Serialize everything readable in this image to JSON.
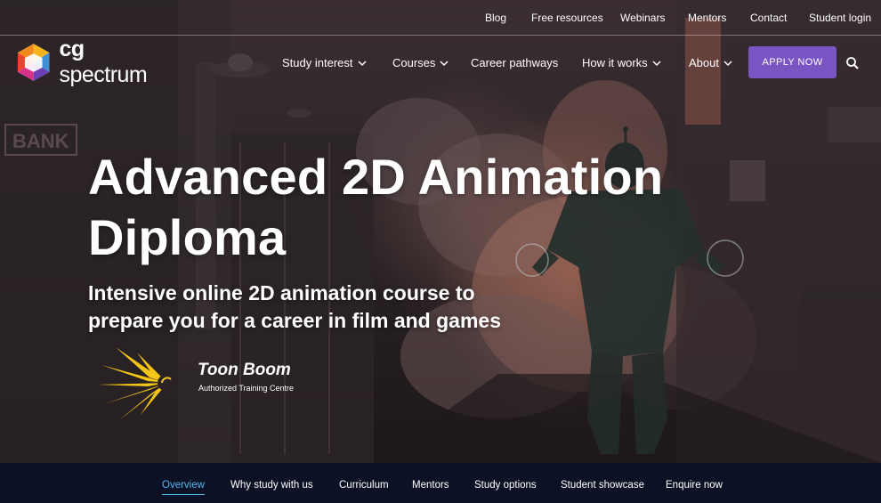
{
  "utility_links": [
    "Blog",
    "Free resources",
    "Webinars",
    "Mentors",
    "Contact",
    "Student login"
  ],
  "logo": {
    "prefix": "cg",
    "suffix": "spectrum"
  },
  "nav": {
    "items": [
      {
        "label": "Study interest",
        "dropdown": true
      },
      {
        "label": "Courses",
        "dropdown": true
      },
      {
        "label": "Career pathways",
        "dropdown": false
      },
      {
        "label": "How it works",
        "dropdown": true
      },
      {
        "label": "About",
        "dropdown": true
      }
    ],
    "apply_label": "APPLY NOW",
    "search_icon": "search-icon"
  },
  "hero": {
    "title_line1": "Advanced 2D Animation",
    "title_line2": "Diploma",
    "subtitle_line1": "Intensive online 2D animation course to",
    "subtitle_line2": "prepare you for a career in film and games",
    "partner_name": "Toon Boom",
    "partner_tagline": "Authorized Training Centre",
    "scene_sign": "BANK"
  },
  "sub_nav": {
    "active_index": 0,
    "items": [
      "Overview",
      "Why study with us",
      "Curriculum",
      "Mentors",
      "Study options",
      "Student showcase",
      "Enquire now"
    ]
  },
  "colors": {
    "accent_purple": "#7b54c4",
    "subnav_bg": "#0d1125",
    "active_link": "#54b8ea",
    "toon_boom_yellow": "#f5c518"
  }
}
